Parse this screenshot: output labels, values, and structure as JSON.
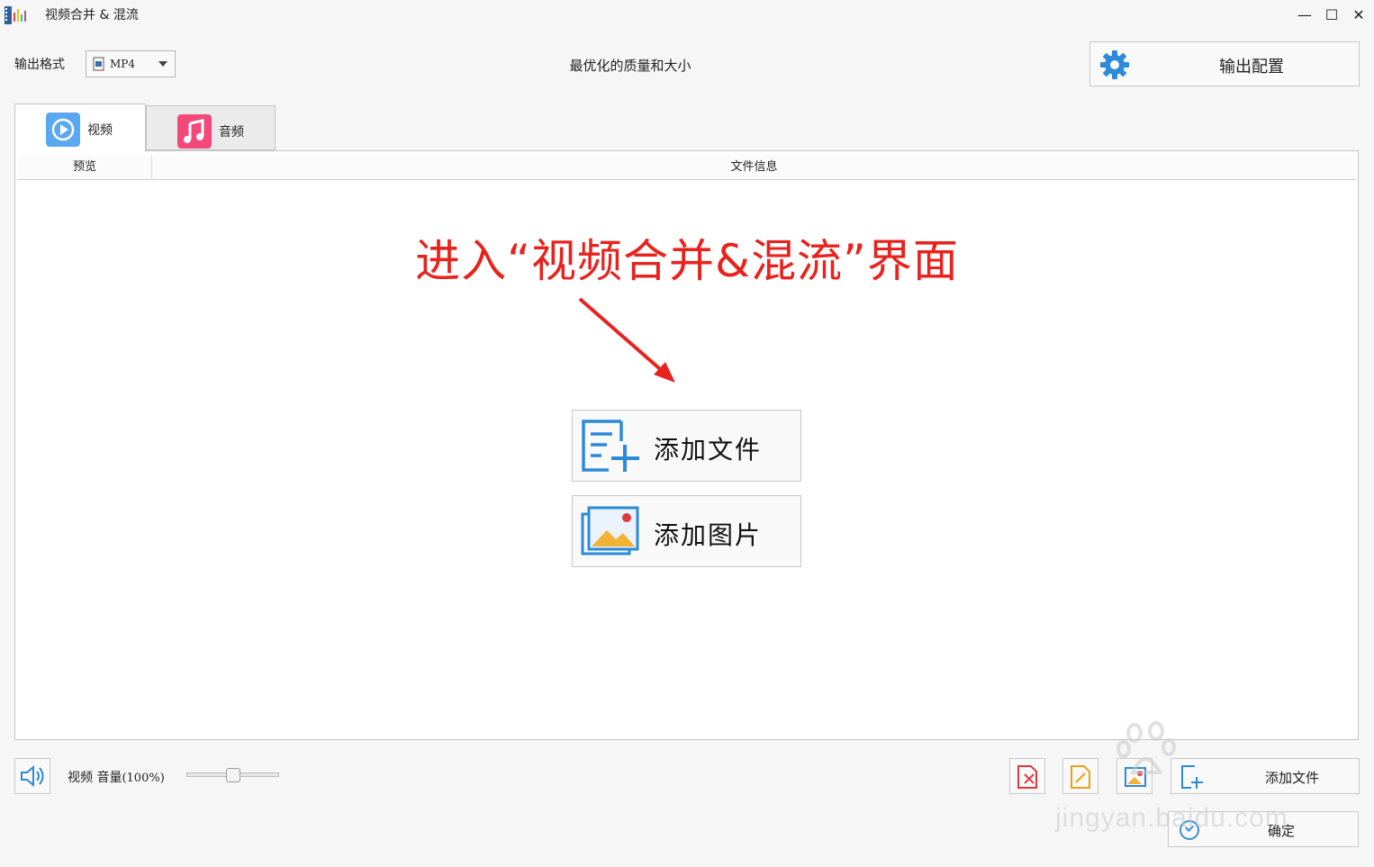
{
  "window": {
    "title": "视频合并 & 混流",
    "minimize_glyph": "—",
    "maximize_glyph": "☐",
    "close_glyph": "✕"
  },
  "toolbar": {
    "format_label": "输出格式",
    "format_value": "MP4",
    "quality_text": "最优化的质量和大小",
    "output_config_label": "输出配置"
  },
  "tabs": [
    {
      "label": "视频",
      "icon": "play-circle-icon",
      "color": "#5ba7f0",
      "selected": true
    },
    {
      "label": "音频",
      "icon": "music-note-icon",
      "color": "#f2487a",
      "selected": false
    }
  ],
  "table": {
    "columns": [
      "预览",
      "文件信息"
    ]
  },
  "annotation": {
    "text": "进入“视频合并&混流”界面",
    "color": "#e8231e"
  },
  "main_buttons": {
    "add_file": "添加文件",
    "add_image": "添加图片"
  },
  "bottom": {
    "volume_label": "视频 音量",
    "volume_percent": "(100%)",
    "volume_level": 0.5,
    "add_file_small": "添加文件",
    "ok": "确定"
  },
  "watermark": {
    "text": "jingyan.baidu.com"
  },
  "colors": {
    "accent_blue": "#2c8ad8",
    "delete_red": "#e2383c"
  }
}
